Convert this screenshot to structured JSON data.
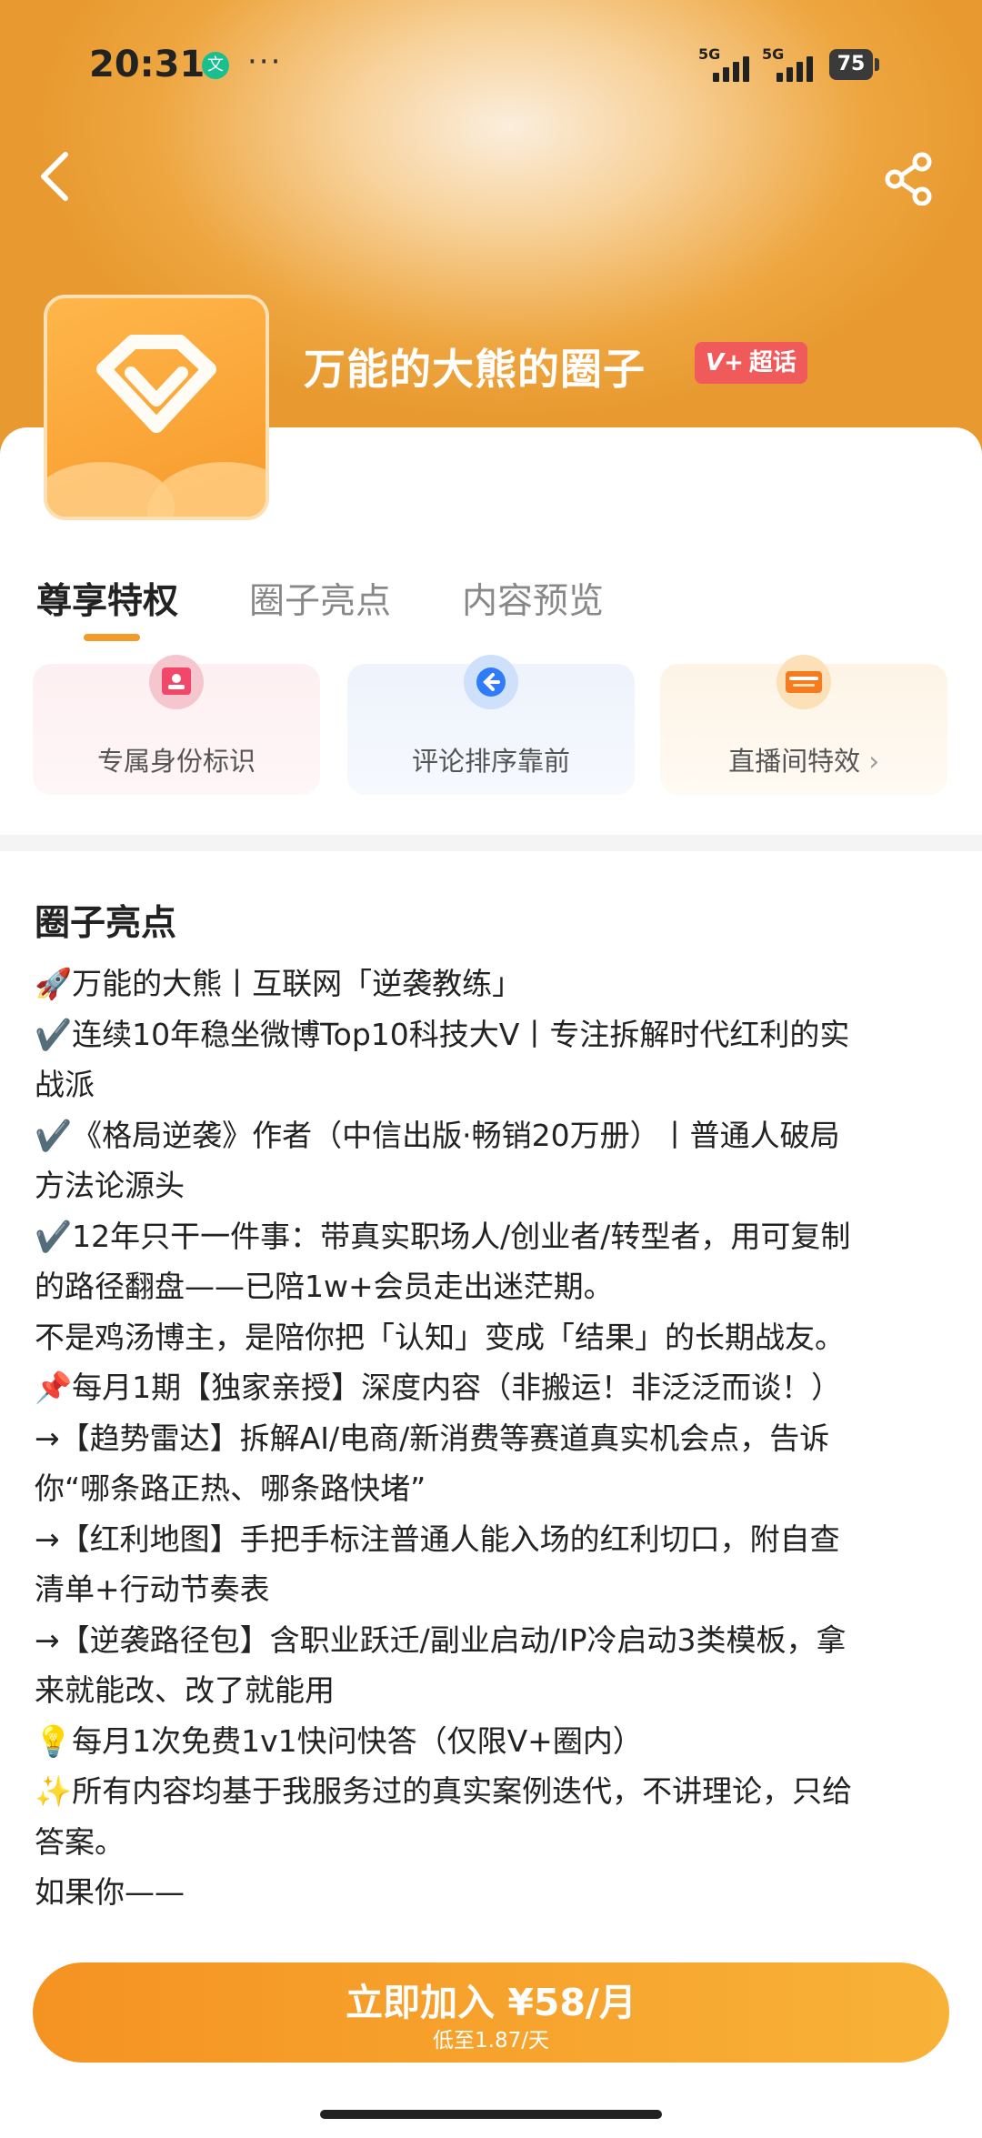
{
  "status": {
    "time": "20:31",
    "app_icon_glyph": "文",
    "more": "···",
    "signal1": "5G",
    "signal2": "5G",
    "battery": "75"
  },
  "header": {
    "back_icon": "chevron-left-icon",
    "share_icon": "share-icon",
    "title": "万能的大熊的圈子",
    "badge_v": "V+",
    "badge_label": "超话"
  },
  "tabs": [
    {
      "label": "尊享特权",
      "active": true
    },
    {
      "label": "圈子亮点",
      "active": false
    },
    {
      "label": "内容预览",
      "active": false
    }
  ],
  "perks": [
    {
      "label": "专属身份标识",
      "icon": "id-badge-icon"
    },
    {
      "label": "评论排序靠前",
      "icon": "comment-arrow-icon"
    },
    {
      "label": "直播间特效",
      "icon": "boom-effect-icon",
      "has_more": true,
      "more_glyph": "›"
    }
  ],
  "highlights": {
    "title": "圈子亮点",
    "lines": [
      "🚀万能的大熊丨互联网「逆袭教练」",
      "✔️连续10年稳坐微博Top10科技大V丨专注拆解时代红利的实",
      "战派",
      "✔️《格局逆袭》作者（中信出版·畅销20万册）丨普通人破局",
      "方法论源头",
      "✔️12年只干一件事：带真实职场人/创业者/转型者，用可复制",
      "的路径翻盘——已陪1w+会员走出迷茫期。",
      "不是鸡汤博主，是陪你把「认知」变成「结果」的长期战友。",
      "📌每月1期【独家亲授】深度内容（非搬运！非泛泛而谈！）",
      "→【趋势雷达】拆解AI/电商/新消费等赛道真实机会点，告诉",
      "你“哪条路正热、哪条路快堵”",
      "→【红利地图】手把手标注普通人能入场的红利切口，附自查",
      "清单+行动节奏表",
      "→【逆袭路径包】含职业跃迁/副业启动/IP冷启动3类模板，拿",
      "来就能改、改了就能用",
      "💡每月1次免费1v1快问快答（仅限V+圈内）",
      "✨所有内容均基于我服务过的真实案例迭代，不讲理论，只给",
      "答案。",
      "如果你——"
    ]
  },
  "join": {
    "label": "立即加入 ¥58/月",
    "sub": "低至1.87/天"
  },
  "colors": {
    "accent": "#f29b2b",
    "badge": "#f05a5a",
    "button_start": "#f59322",
    "button_end": "#f8b237"
  }
}
